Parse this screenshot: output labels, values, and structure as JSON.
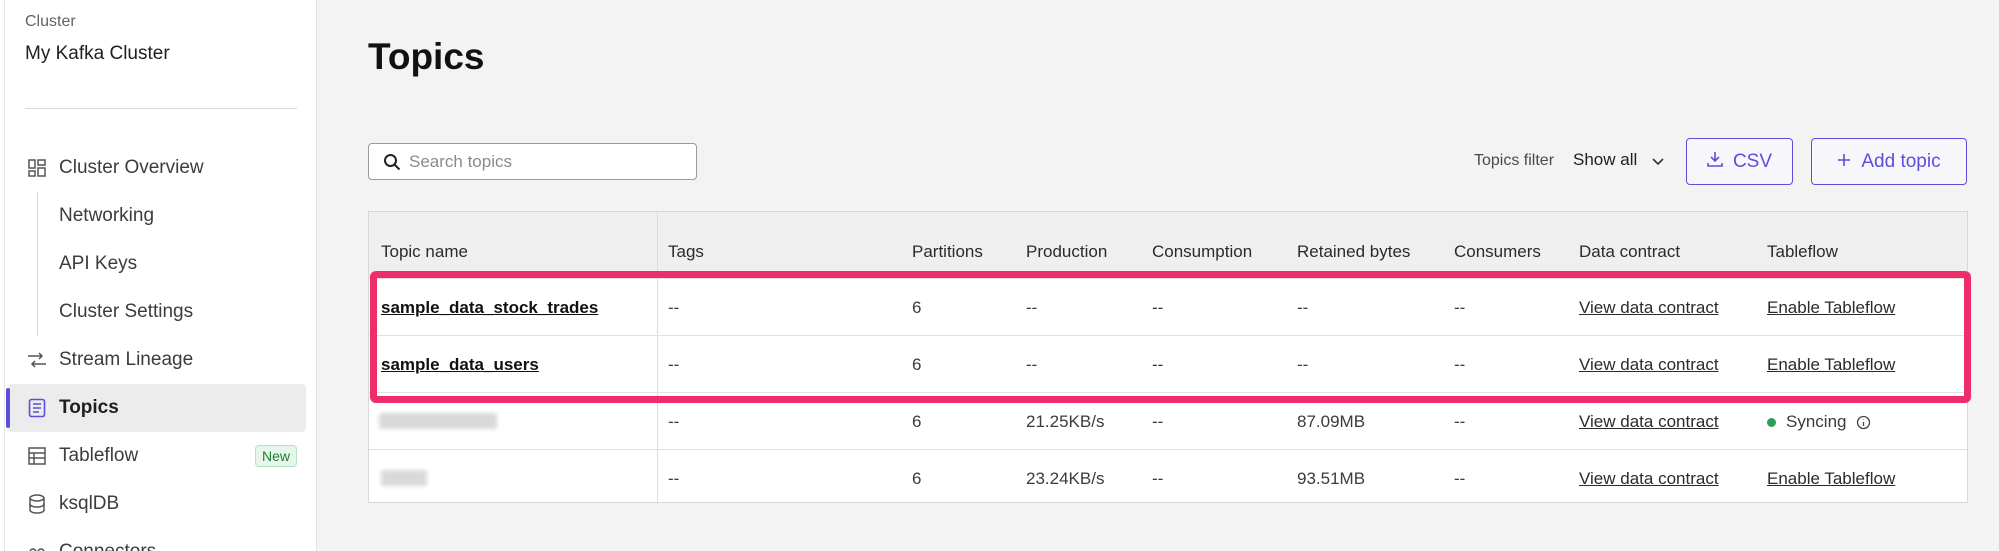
{
  "sidebar": {
    "cluster_label": "Cluster",
    "cluster_name": "My Kafka Cluster",
    "items": [
      {
        "label": "Cluster Overview",
        "icon": "dashboard-icon"
      },
      {
        "label": "Networking"
      },
      {
        "label": "API Keys"
      },
      {
        "label": "Cluster Settings"
      },
      {
        "label": "Stream Lineage",
        "icon": "lineage-icon"
      },
      {
        "label": "Topics",
        "icon": "document-icon",
        "active": true
      },
      {
        "label": "Tableflow",
        "icon": "table-icon",
        "badge": "New"
      },
      {
        "label": "ksqlDB",
        "icon": "database-icon"
      },
      {
        "label": "Connectors",
        "icon": "connector-icon"
      }
    ]
  },
  "main": {
    "title": "Topics",
    "search": {
      "placeholder": "Search topics",
      "icon": "search-icon"
    },
    "filter": {
      "label": "Topics filter",
      "value": "Show all"
    },
    "buttons": {
      "csv": "CSV",
      "add_topic": "Add topic"
    }
  },
  "table": {
    "columns": [
      "Topic name",
      "Tags",
      "Partitions",
      "Production",
      "Consumption",
      "Retained bytes",
      "Consumers",
      "Data contract",
      "Tableflow"
    ],
    "rows": [
      {
        "topic": "sample_data_stock_trades",
        "tags": "--",
        "partitions": "6",
        "production": "--",
        "consumption": "--",
        "retained": "--",
        "consumers": "--",
        "contract": "View data contract",
        "tableflow": "Enable Tableflow"
      },
      {
        "topic": "sample_data_users",
        "tags": "--",
        "partitions": "6",
        "production": "--",
        "consumption": "--",
        "retained": "--",
        "consumers": "--",
        "contract": "View data contract",
        "tableflow": "Enable Tableflow"
      },
      {
        "topic": "",
        "tags": "--",
        "partitions": "6",
        "production": "21.25KB/s",
        "consumption": "--",
        "retained": "87.09MB",
        "consumers": "--",
        "contract": "View data contract",
        "tableflow": "Syncing"
      },
      {
        "topic": "",
        "tags": "--",
        "partitions": "6",
        "production": "23.24KB/s",
        "consumption": "--",
        "retained": "93.51MB",
        "consumers": "--",
        "contract": "View data contract",
        "tableflow": "Enable Tableflow"
      }
    ]
  },
  "colors": {
    "accent": "#5b4fd8",
    "highlight": "#ee2e6b",
    "sync": "#2e9e5b"
  }
}
